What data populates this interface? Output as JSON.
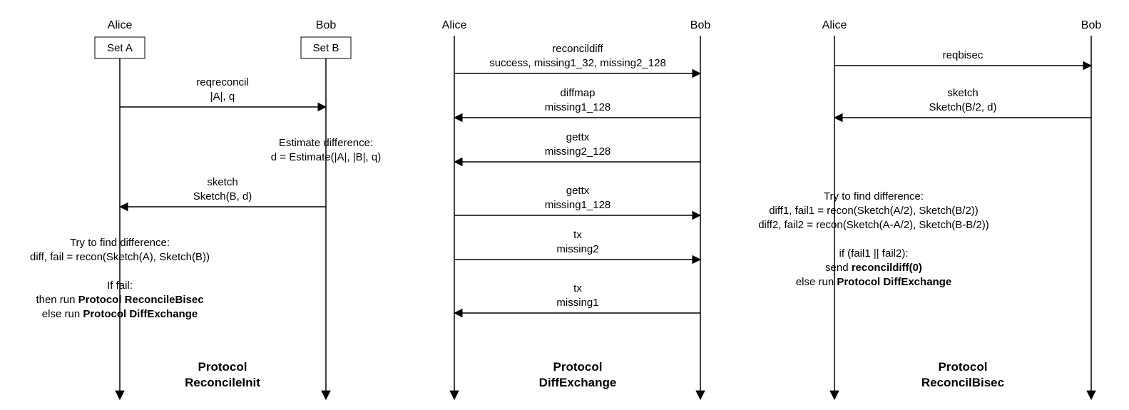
{
  "actors": {
    "alice": "Alice",
    "bob": "Bob"
  },
  "panel1": {
    "setA": "Set A",
    "setB": "Set B",
    "msg_reqreconcil_name": "reqreconcil",
    "msg_reqreconcil_params": "|A|, q",
    "note_bob_l1": "Estimate difference:",
    "note_bob_l2": "d = Estimate(|A|, |B|, q)",
    "msg_sketch_name": "sketch",
    "msg_sketch_params": "Sketch(B, d)",
    "note_alice_l1": "Try to find difference:",
    "note_alice_l2": "diff, fail = recon(Sketch(A), Sketch(B))",
    "note_alice_l3": "If fail:",
    "note_alice_l4a": "then run ",
    "note_alice_l4b": "Protocol ReconcileBisec",
    "note_alice_l5a": "else run ",
    "note_alice_l5b": "Protocol DiffExchange",
    "proto_l1": "Protocol",
    "proto_l2": "ReconcileInit"
  },
  "panel2": {
    "m1_name": "reconcildiff",
    "m1_params": "success, missing1_32, missing2_128",
    "m2_name": "diffmap",
    "m2_params": "missing1_128",
    "m3_name": "gettx",
    "m3_params": "missing2_128",
    "m4_name": "gettx",
    "m4_params": "missing1_128",
    "m5_name": "tx",
    "m5_params": "missing2",
    "m6_name": "tx",
    "m6_params": "missing1",
    "proto_l1": "Protocol",
    "proto_l2": "DiffExchange"
  },
  "panel3": {
    "m1_name": "reqbisec",
    "m2_name": "sketch",
    "m2_params": "Sketch(B/2, d)",
    "note_l1": "Try to find difference:",
    "note_l2": "diff1, fail1 = recon(Sketch(A/2), Sketch(B/2))",
    "note_l3": "diff2, fail2 = recon(Sketch(A-A/2), Sketch(B-B/2))",
    "note_l4": "if (fail1 || fail2):",
    "note_l5a": "send ",
    "note_l5b": "reconcildiff(0)",
    "note_l6a": "else run ",
    "note_l6b": "Protocol DiffExchange",
    "proto_l1": "Protocol",
    "proto_l2": "ReconcilBisec"
  }
}
